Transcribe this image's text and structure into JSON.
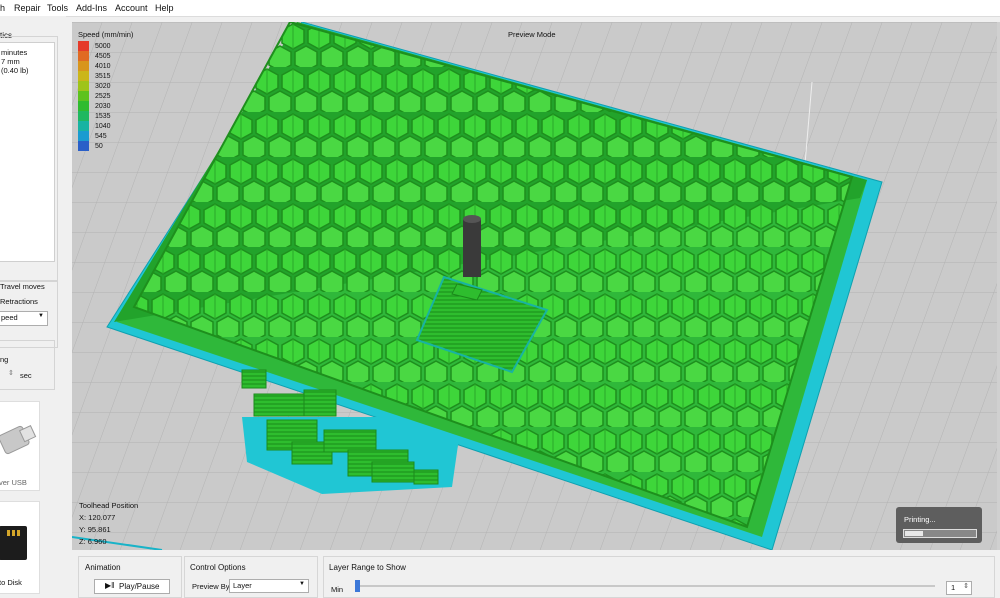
{
  "menu": {
    "items": [
      "h",
      "Repair",
      "Tools",
      "Add-Ins",
      "Account",
      "Help"
    ]
  },
  "left_panel": {
    "stats_title": "tics",
    "stats_lines": [
      "minutes",
      "7 mm",
      "(0.40 lb)"
    ],
    "show_travel_label": "Travel moves",
    "show_retractions_label": "Retractions",
    "color_by_value": "peed",
    "timing_label": "ng",
    "timing_unit": "sec",
    "usb_label": "ver USB",
    "disk_label": "to Disk"
  },
  "viewport": {
    "title": "Preview Mode",
    "legend_title": "Speed (mm/min)",
    "legend": [
      {
        "label": "5000",
        "color": "#e53a2a"
      },
      {
        "label": "4505",
        "color": "#e06a23"
      },
      {
        "label": "4010",
        "color": "#d8951c"
      },
      {
        "label": "3515",
        "color": "#cbb619"
      },
      {
        "label": "3020",
        "color": "#9fc41a"
      },
      {
        "label": "2525",
        "color": "#5dc21e"
      },
      {
        "label": "2030",
        "color": "#2fbb2e"
      },
      {
        "label": "1535",
        "color": "#1fb860"
      },
      {
        "label": "1040",
        "color": "#18b3a2"
      },
      {
        "label": "545",
        "color": "#1a9bd0"
      },
      {
        "label": "50",
        "color": "#2a5fc8"
      }
    ],
    "toolhead_title": "Toolhead Position",
    "toolhead_x": "X: 120.077",
    "toolhead_y": "Y: 95.861",
    "toolhead_z": "Z: 6.960",
    "toast_text": "Printing...",
    "toast_progress": 0.25
  },
  "bottom": {
    "animation_title": "Animation",
    "play_label": "Play/Pause",
    "control_title": "Control Options",
    "preview_by_label": "Preview By",
    "preview_by_value": "Layer",
    "layer_range_title": "Layer Range to Show",
    "min_label": "Min",
    "min_value": "1"
  }
}
